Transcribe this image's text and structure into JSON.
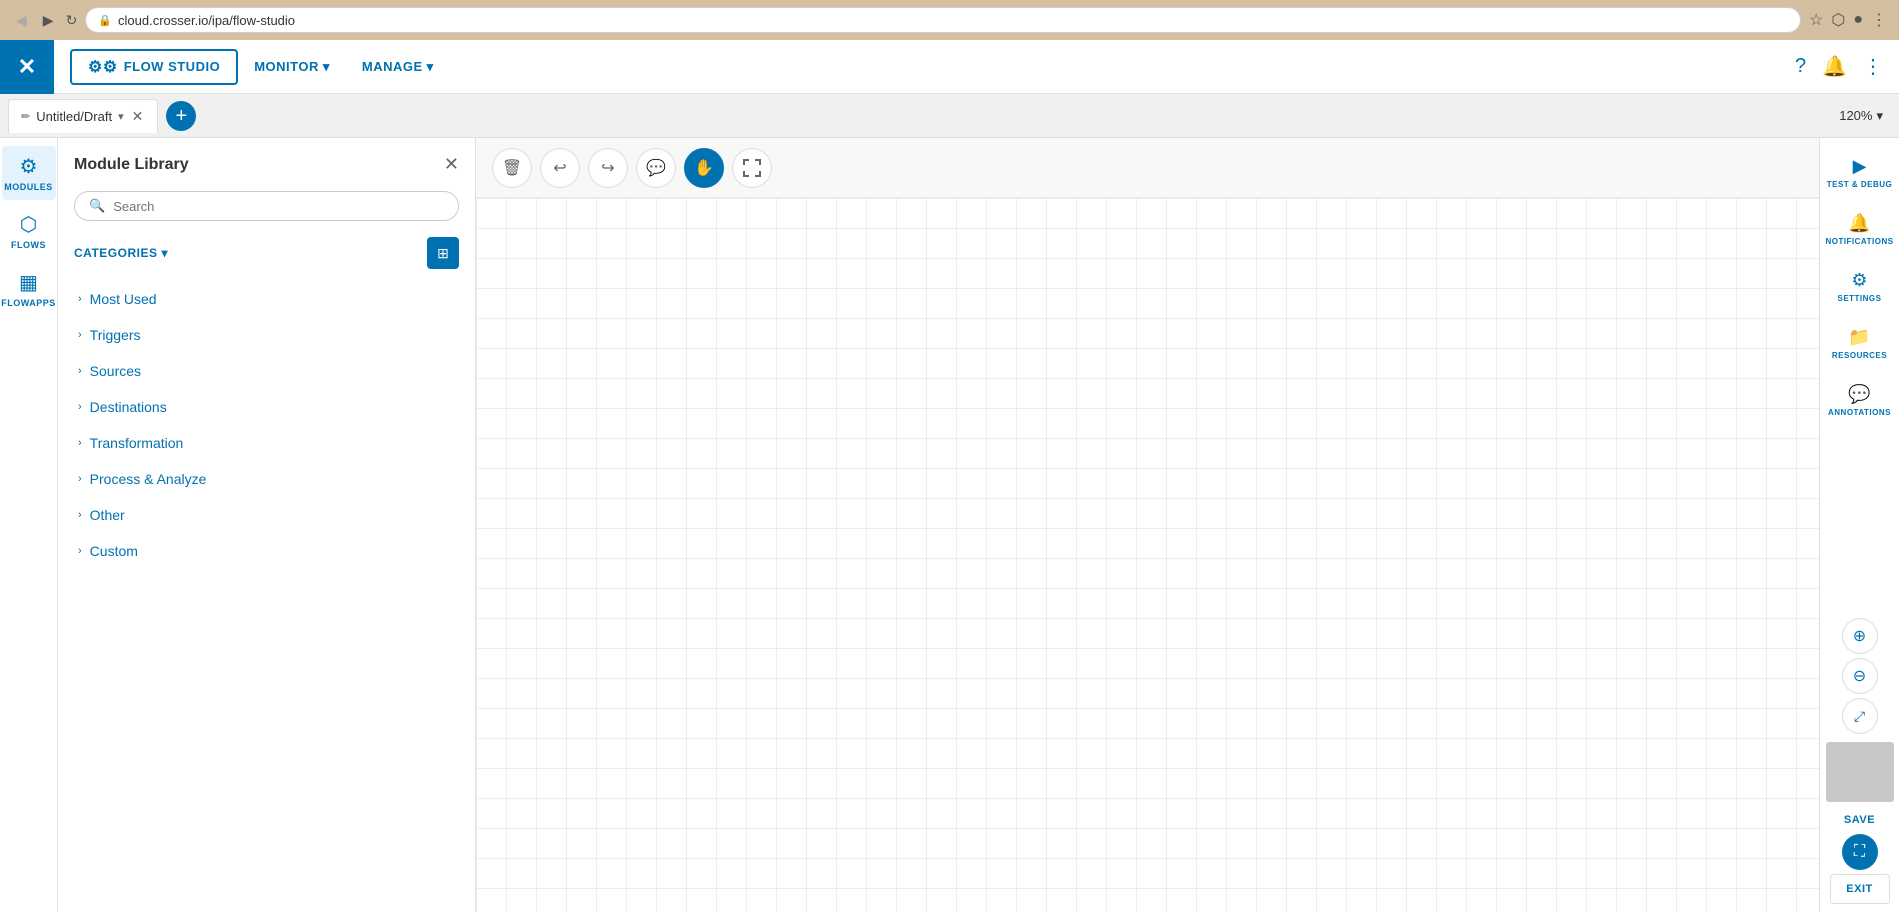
{
  "browser": {
    "url": "cloud.crosser.io/ipa/flow-studio",
    "back_disabled": true,
    "forward_disabled": false
  },
  "top_nav": {
    "logo_text": "✕",
    "brand_label": "FLOW STUDIO",
    "monitor_label": "MONITOR",
    "manage_label": "MANAGE"
  },
  "tab_bar": {
    "tab_icon": "✏",
    "tab_title": "Untitled/Draft",
    "zoom_label": "120%"
  },
  "left_sidebar": {
    "items": [
      {
        "id": "modules",
        "icon": "⚙",
        "label": "MODULES",
        "active": true
      },
      {
        "id": "flows",
        "icon": "⬡",
        "label": "FLOWS",
        "active": false
      },
      {
        "id": "flowapps",
        "icon": "▦",
        "label": "FLOWAPPS",
        "active": false
      }
    ]
  },
  "module_library": {
    "title": "Module Library",
    "search_placeholder": "Search",
    "categories_label": "CATEGORIES",
    "categories": [
      {
        "id": "most-used",
        "label": "Most Used"
      },
      {
        "id": "triggers",
        "label": "Triggers"
      },
      {
        "id": "sources",
        "label": "Sources"
      },
      {
        "id": "destinations",
        "label": "Destinations"
      },
      {
        "id": "transformation",
        "label": "Transformation"
      },
      {
        "id": "process-analyze",
        "label": "Process & Analyze"
      },
      {
        "id": "other",
        "label": "Other"
      },
      {
        "id": "custom",
        "label": "Custom"
      }
    ]
  },
  "canvas_toolbar": {
    "tools": [
      {
        "id": "delete",
        "icon": "🗑",
        "active": false
      },
      {
        "id": "undo",
        "icon": "↩",
        "active": false
      },
      {
        "id": "redo",
        "icon": "↪",
        "active": false
      },
      {
        "id": "comment",
        "icon": "💬",
        "active": false
      },
      {
        "id": "select",
        "icon": "✋",
        "active": true
      },
      {
        "id": "marquee",
        "icon": "⬚",
        "active": false
      }
    ]
  },
  "right_sidebar": {
    "items": [
      {
        "id": "test-debug",
        "icon": "▶",
        "label": "TEST & DEBUG"
      },
      {
        "id": "notifications",
        "icon": "🔔",
        "label": "NOTIFICATIONS"
      },
      {
        "id": "settings",
        "icon": "⚙",
        "label": "SETTINGS"
      },
      {
        "id": "resources",
        "icon": "📁",
        "label": "RESOURCES"
      },
      {
        "id": "annotations",
        "icon": "💬",
        "label": "ANNOTATIONS"
      }
    ],
    "save_label": "SAVE",
    "exit_label": "EXIT"
  },
  "colors": {
    "primary": "#0072b1",
    "bg_light": "#f8f8f8",
    "border": "#e0e0e0",
    "text_dark": "#333333",
    "text_muted": "#666666"
  }
}
